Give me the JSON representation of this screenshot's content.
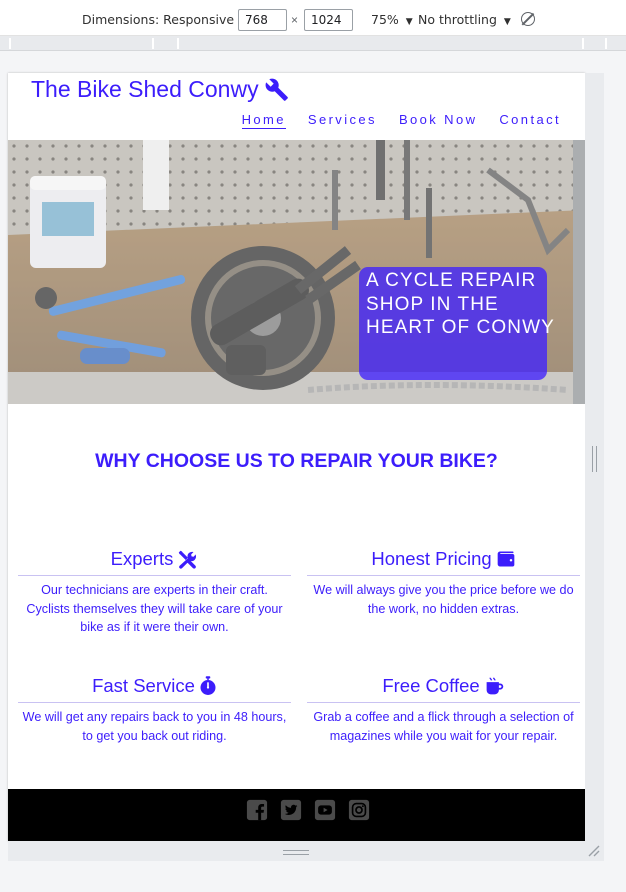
{
  "devtools": {
    "dimensions_label": "Dimensions: Responsive",
    "width": "768",
    "height": "1024",
    "times": "×",
    "zoom": "75%",
    "throttling": "No throttling",
    "caret": "▼"
  },
  "site": {
    "brand": "The Bike Shed Conwy",
    "nav": [
      {
        "label": "Home",
        "active": true
      },
      {
        "label": "Services",
        "active": false
      },
      {
        "label": "Book Now",
        "active": false
      },
      {
        "label": "Contact",
        "active": false
      }
    ],
    "hero": {
      "lines": [
        "A CYCLE REPAIR",
        "SHOP IN THE",
        "HEART OF CONWY"
      ]
    },
    "why_title": "WHY CHOOSE US TO REPAIR YOUR BIKE?",
    "features": [
      {
        "title": "Experts",
        "icon": "tools-icon",
        "text": "Our technicians are experts in their craft. Cyclists themselves they will take care of your bike as if it were their own."
      },
      {
        "title": "Honest Pricing",
        "icon": "wallet-icon",
        "text": "We will always give you the price before we do the work, no hidden extras."
      },
      {
        "title": "Fast Service",
        "icon": "stopwatch-icon",
        "text": "We will get any repairs back to you in 48 hours, to get you back out riding."
      },
      {
        "title": "Free Coffee",
        "icon": "coffee-mug-icon",
        "text": "Grab a coffee and a flick through a selection of magazines while you wait for your repair."
      }
    ],
    "social": [
      "facebook-icon",
      "twitter-icon",
      "youtube-icon",
      "instagram-icon"
    ],
    "colors": {
      "accent": "#3c1dfb",
      "footer": "#000000",
      "social_icons": "#4a4a4a"
    }
  }
}
